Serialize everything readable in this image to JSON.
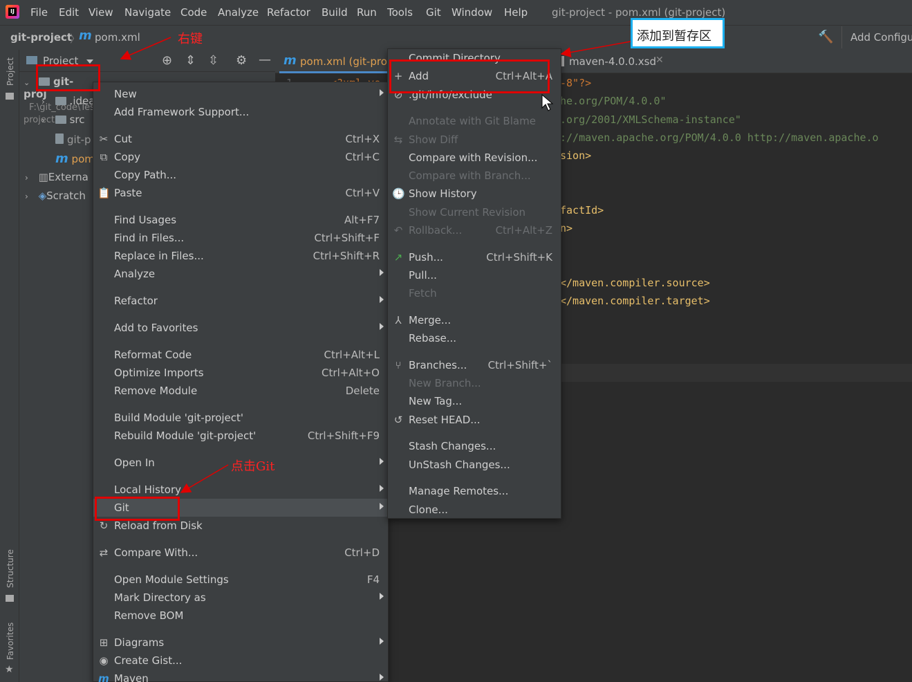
{
  "menubar": {
    "items": [
      "File",
      "Edit",
      "View",
      "Navigate",
      "Code",
      "Analyze",
      "Refactor",
      "Build",
      "Run",
      "Tools",
      "Git",
      "Window",
      "Help"
    ],
    "window_title": "git-project - pom.xml (git-project)"
  },
  "navbar": {
    "project": "git-project",
    "file_icon": "m",
    "file": "pom.xml"
  },
  "toolbar": {
    "add_config": "Add Configu"
  },
  "side_tabs": {
    "project": "Project",
    "structure": "Structure",
    "favorites": "Favorites"
  },
  "project_panel": {
    "title": "Project",
    "tree": [
      {
        "label": "git-proj",
        "path": "F:\\git_code\\Test\\git-project"
      },
      {
        "label": ".idea"
      },
      {
        "label": "src"
      },
      {
        "label": "git-p"
      },
      {
        "label": "pom"
      },
      {
        "label": "Externa"
      },
      {
        "label": "Scratch"
      }
    ]
  },
  "editor": {
    "tabs": [
      {
        "label": "pom.xml (git-pro"
      },
      {
        "label": "maven-4.0.0.xsd"
      }
    ],
    "line_number": "1",
    "lines": [
      {
        "text": "<?xml ve",
        "color": "#cc7832"
      },
      {
        "text": "-8\"?>",
        "color": "#cc7832"
      },
      {
        "text": "he.org/POM/4.0.0\"",
        "color": "#6a8759"
      },
      {
        "text": ".org/2001/XMLSchema-instance\"",
        "color": "#6a8759"
      },
      {
        "text": "://maven.apache.org/POM/4.0.0 http://maven.apache.o",
        "color": "#6a8759"
      },
      {
        "text": "sion>",
        "color": "#e8bf6a"
      },
      {
        "text": "factId>",
        "color": "#e8bf6a"
      },
      {
        "text": "n>",
        "color": "#e8bf6a"
      },
      {
        "text": "</maven.compiler.source>",
        "color": "#e8bf6a"
      },
      {
        "text": "</maven.compiler.target>",
        "color": "#e8bf6a"
      }
    ]
  },
  "context_menu": {
    "items": [
      {
        "icon": "",
        "label": "New",
        "shortcut": "",
        "submenu": true
      },
      {
        "icon": "",
        "label": "Add Framework Support...",
        "shortcut": ""
      },
      {
        "icon": "✂",
        "label": "Cut",
        "shortcut": "Ctrl+X"
      },
      {
        "icon": "⧉",
        "label": "Copy",
        "shortcut": "Ctrl+C"
      },
      {
        "icon": "",
        "label": "Copy Path...",
        "shortcut": ""
      },
      {
        "icon": "📋",
        "label": "Paste",
        "shortcut": "Ctrl+V"
      },
      {
        "icon": "",
        "label": "Find Usages",
        "shortcut": "Alt+F7"
      },
      {
        "icon": "",
        "label": "Find in Files...",
        "shortcut": "Ctrl+Shift+F"
      },
      {
        "icon": "",
        "label": "Replace in Files...",
        "shortcut": "Ctrl+Shift+R"
      },
      {
        "icon": "",
        "label": "Analyze",
        "shortcut": "",
        "submenu": true
      },
      {
        "icon": "",
        "label": "Refactor",
        "shortcut": "",
        "submenu": true
      },
      {
        "icon": "",
        "label": "Add to Favorites",
        "shortcut": "",
        "submenu": true
      },
      {
        "icon": "",
        "label": "Reformat Code",
        "shortcut": "Ctrl+Alt+L"
      },
      {
        "icon": "",
        "label": "Optimize Imports",
        "shortcut": "Ctrl+Alt+O"
      },
      {
        "icon": "",
        "label": "Remove Module",
        "shortcut": "Delete"
      },
      {
        "icon": "",
        "label": "Build Module 'git-project'",
        "shortcut": ""
      },
      {
        "icon": "",
        "label": "Rebuild Module 'git-project'",
        "shortcut": "Ctrl+Shift+F9"
      },
      {
        "icon": "",
        "label": "Open In",
        "shortcut": "",
        "submenu": true
      },
      {
        "icon": "",
        "label": "Local History",
        "shortcut": "",
        "submenu": true
      },
      {
        "icon": "",
        "label": "Git",
        "shortcut": "",
        "submenu": true,
        "selected": true
      },
      {
        "icon": "↻",
        "label": "Reload from Disk",
        "shortcut": ""
      },
      {
        "icon": "⇄",
        "label": "Compare With...",
        "shortcut": "Ctrl+D"
      },
      {
        "icon": "",
        "label": "Open Module Settings",
        "shortcut": "F4"
      },
      {
        "icon": "",
        "label": "Mark Directory as",
        "shortcut": "",
        "submenu": true
      },
      {
        "icon": "",
        "label": "Remove BOM",
        "shortcut": ""
      },
      {
        "icon": "⊞",
        "label": "Diagrams",
        "shortcut": "",
        "submenu": true
      },
      {
        "icon": "◉",
        "label": "Create Gist...",
        "shortcut": ""
      },
      {
        "icon": "m",
        "label": "Maven",
        "shortcut": "",
        "submenu": true
      }
    ]
  },
  "git_submenu": {
    "items": [
      {
        "icon": "",
        "label": "Commit Directory...",
        "shortcut": ""
      },
      {
        "icon": "+",
        "label": "Add",
        "shortcut": "Ctrl+Alt+A"
      },
      {
        "icon": "⊘",
        "label": ".git/info/exclude",
        "shortcut": ""
      },
      {
        "icon": "",
        "label": "Annotate with Git Blame",
        "shortcut": "",
        "disabled": true
      },
      {
        "icon": "⇆",
        "label": "Show Diff",
        "shortcut": "",
        "disabled": true
      },
      {
        "icon": "",
        "label": "Compare with Revision...",
        "shortcut": ""
      },
      {
        "icon": "",
        "label": "Compare with Branch...",
        "shortcut": "",
        "disabled": true
      },
      {
        "icon": "🕒",
        "label": "Show History",
        "shortcut": ""
      },
      {
        "icon": "",
        "label": "Show Current Revision",
        "shortcut": "",
        "disabled": true
      },
      {
        "icon": "↶",
        "label": "Rollback...",
        "shortcut": "Ctrl+Alt+Z",
        "disabled": true
      },
      {
        "icon": "↗",
        "label": "Push...",
        "shortcut": "Ctrl+Shift+K"
      },
      {
        "icon": "",
        "label": "Pull...",
        "shortcut": ""
      },
      {
        "icon": "",
        "label": "Fetch",
        "shortcut": "",
        "disabled": true
      },
      {
        "icon": "⅄",
        "label": "Merge...",
        "shortcut": ""
      },
      {
        "icon": "",
        "label": "Rebase...",
        "shortcut": ""
      },
      {
        "icon": "⑂",
        "label": "Branches...",
        "shortcut": "Ctrl+Shift+`"
      },
      {
        "icon": "",
        "label": "New Branch...",
        "shortcut": "",
        "disabled": true
      },
      {
        "icon": "",
        "label": "New Tag...",
        "shortcut": ""
      },
      {
        "icon": "↺",
        "label": "Reset HEAD...",
        "shortcut": ""
      },
      {
        "icon": "",
        "label": "Stash Changes...",
        "shortcut": ""
      },
      {
        "icon": "",
        "label": "UnStash Changes...",
        "shortcut": ""
      },
      {
        "icon": "",
        "label": "Manage Remotes...",
        "shortcut": ""
      },
      {
        "icon": "",
        "label": "Clone...",
        "shortcut": ""
      }
    ]
  },
  "annotations": {
    "right_click": "右键",
    "click_git": "点击Git",
    "add_to_stage": "添加到暂存区"
  },
  "colors": {
    "accent_red": "#e00000",
    "accent_blue": "#1cb0f0",
    "maven_m": "#3b9ae1"
  }
}
